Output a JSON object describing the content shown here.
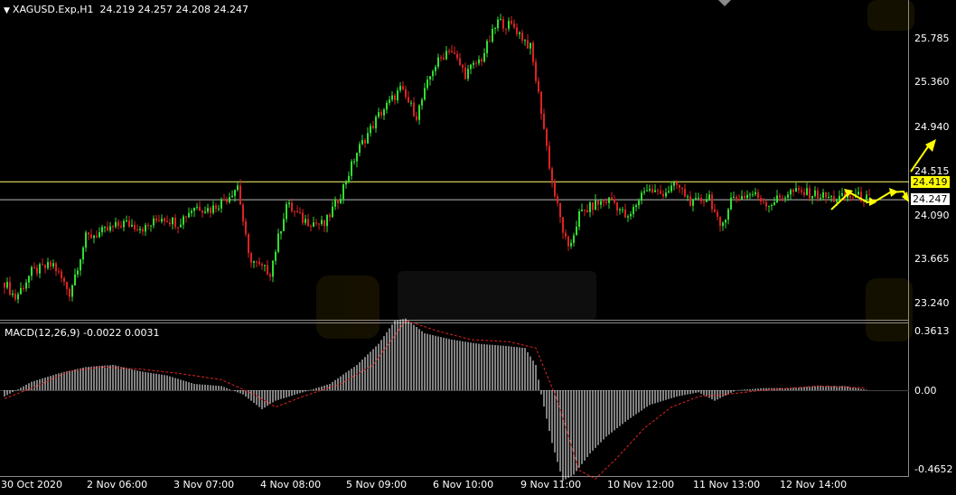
{
  "header": {
    "symbol": "XAGUSD.Exp,H1",
    "ohlc": "24.219 24.257 24.208 24.247"
  },
  "macd": {
    "label": "MACD(12,26,9) -0.0022 0.0031"
  },
  "colors": {
    "background": "#000000",
    "bull_candle": "#33dd33",
    "bear_candle": "#dd2222",
    "macd_hist": "#ffffff",
    "signal_line": "#dd2222",
    "hline_upper": "#ffff66",
    "hline_lower": "#cccccc",
    "forecast_arrow": "#ffff00"
  },
  "chart_data": {
    "type": "candlestick",
    "symbol": "XAGUSD.Exp",
    "timeframe": "H1",
    "price_axis_labels": [
      "25.785",
      "25.360",
      "24.940",
      "24.515",
      "24.090",
      "23.665",
      "23.240"
    ],
    "highlight_levels": [
      {
        "label": "24.419",
        "value": 24.419,
        "style": "yellow"
      },
      {
        "label": "24.247",
        "value": 24.247,
        "style": "white"
      }
    ],
    "time_labels": [
      "30 Oct 2020",
      "2 Nov 06:00",
      "3 Nov 07:00",
      "4 Nov 08:00",
      "5 Nov 09:00",
      "6 Nov 10:00",
      "9 Nov 11:00",
      "10 Nov 12:00",
      "11 Nov 13:00",
      "12 Nov 14:00"
    ],
    "close_path": [
      [
        0,
        23.45
      ],
      [
        4,
        23.3
      ],
      [
        10,
        23.55
      ],
      [
        18,
        23.62
      ],
      [
        24,
        23.35
      ],
      [
        30,
        23.88
      ],
      [
        38,
        23.95
      ],
      [
        44,
        24.02
      ],
      [
        52,
        23.97
      ],
      [
        58,
        24.08
      ],
      [
        64,
        24.02
      ],
      [
        70,
        24.18
      ],
      [
        76,
        24.15
      ],
      [
        82,
        24.26
      ],
      [
        86,
        24.38
      ],
      [
        90,
        23.7
      ],
      [
        94,
        23.6
      ],
      [
        98,
        23.55
      ],
      [
        104,
        24.2
      ],
      [
        110,
        24.05
      ],
      [
        118,
        24.0
      ],
      [
        124,
        24.3
      ],
      [
        130,
        24.7
      ],
      [
        138,
        25.05
      ],
      [
        146,
        25.3
      ],
      [
        152,
        25.05
      ],
      [
        158,
        25.5
      ],
      [
        164,
        25.7
      ],
      [
        170,
        25.45
      ],
      [
        176,
        25.6
      ],
      [
        182,
        25.95
      ],
      [
        188,
        25.9
      ],
      [
        194,
        25.7
      ],
      [
        198,
        25.1
      ],
      [
        202,
        24.4
      ],
      [
        206,
        23.95
      ],
      [
        208,
        23.75
      ],
      [
        212,
        24.1
      ],
      [
        218,
        24.2
      ],
      [
        224,
        24.25
      ],
      [
        230,
        24.05
      ],
      [
        236,
        24.35
      ],
      [
        242,
        24.3
      ],
      [
        248,
        24.38
      ],
      [
        254,
        24.2
      ],
      [
        260,
        24.28
      ],
      [
        264,
        23.95
      ],
      [
        268,
        24.25
      ],
      [
        276,
        24.3
      ],
      [
        282,
        24.2
      ],
      [
        290,
        24.32
      ],
      [
        298,
        24.3
      ],
      [
        306,
        24.25
      ],
      [
        314,
        24.28
      ],
      [
        319,
        24.247
      ]
    ],
    "macd_axis_labels": [
      "0.3613",
      "0.00",
      "-0.4652"
    ],
    "macd_histogram_path": [
      [
        0,
        -0.03
      ],
      [
        10,
        0.04
      ],
      [
        20,
        0.08
      ],
      [
        30,
        0.11
      ],
      [
        40,
        0.12
      ],
      [
        50,
        0.09
      ],
      [
        60,
        0.07
      ],
      [
        70,
        0.03
      ],
      [
        80,
        0.02
      ],
      [
        88,
        -0.02
      ],
      [
        95,
        -0.09
      ],
      [
        100,
        -0.05
      ],
      [
        110,
        -0.01
      ],
      [
        120,
        0.03
      ],
      [
        130,
        0.12
      ],
      [
        138,
        0.22
      ],
      [
        144,
        0.33
      ],
      [
        148,
        0.34
      ],
      [
        155,
        0.27
      ],
      [
        165,
        0.24
      ],
      [
        175,
        0.22
      ],
      [
        185,
        0.21
      ],
      [
        192,
        0.2
      ],
      [
        196,
        0.12
      ],
      [
        198,
        -0.02
      ],
      [
        202,
        -0.25
      ],
      [
        206,
        -0.43
      ],
      [
        210,
        -0.4
      ],
      [
        216,
        -0.3
      ],
      [
        222,
        -0.22
      ],
      [
        230,
        -0.14
      ],
      [
        238,
        -0.07
      ],
      [
        248,
        -0.03
      ],
      [
        256,
        -0.01
      ],
      [
        262,
        -0.05
      ],
      [
        270,
        0.0
      ],
      [
        280,
        0.01
      ],
      [
        290,
        0.01
      ],
      [
        300,
        0.02
      ],
      [
        310,
        0.02
      ],
      [
        319,
        0.0
      ]
    ],
    "signal_path": [
      [
        0,
        -0.04
      ],
      [
        12,
        0.02
      ],
      [
        24,
        0.09
      ],
      [
        36,
        0.11
      ],
      [
        50,
        0.1
      ],
      [
        64,
        0.08
      ],
      [
        80,
        0.05
      ],
      [
        92,
        -0.02
      ],
      [
        100,
        -0.08
      ],
      [
        110,
        -0.03
      ],
      [
        124,
        0.03
      ],
      [
        136,
        0.12
      ],
      [
        148,
        0.33
      ],
      [
        160,
        0.28
      ],
      [
        172,
        0.24
      ],
      [
        186,
        0.23
      ],
      [
        196,
        0.2
      ],
      [
        204,
        -0.05
      ],
      [
        212,
        -0.38
      ],
      [
        218,
        -0.42
      ],
      [
        226,
        -0.32
      ],
      [
        236,
        -0.18
      ],
      [
        246,
        -0.08
      ],
      [
        256,
        -0.03
      ],
      [
        266,
        -0.02
      ],
      [
        280,
        0.0
      ],
      [
        300,
        0.02
      ],
      [
        319,
        0.01
      ]
    ]
  }
}
